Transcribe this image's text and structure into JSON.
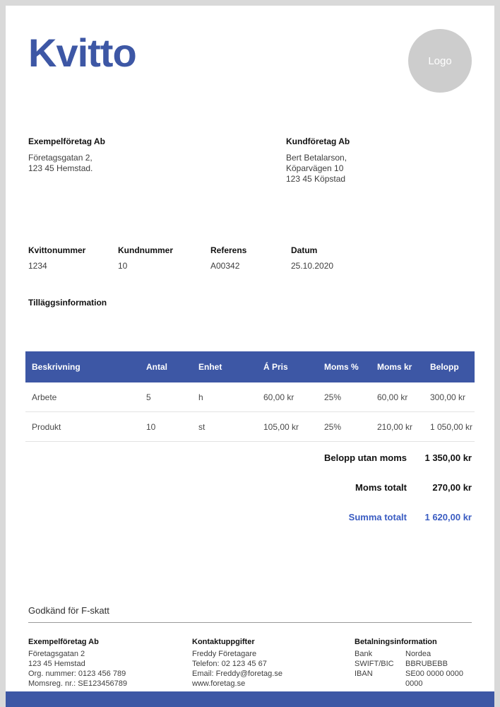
{
  "header": {
    "title": "Kvitto",
    "logo_text": "Logo"
  },
  "colors": {
    "accent": "#3D57A5",
    "summa": "#3A5CC2",
    "page_border": "#D9D9D9",
    "logo_bg": "#CDCDCD"
  },
  "seller": {
    "name": "Exempelföretag Ab",
    "lines": [
      "Företagsgatan 2,",
      "123 45 Hemstad."
    ]
  },
  "buyer": {
    "name": "Kundföretag Ab",
    "lines": [
      "Bert Betalarson,",
      "Köparvägen 10",
      "123 45 Köpstad"
    ]
  },
  "meta": {
    "fields": [
      {
        "label": "Kvittonummer",
        "value": "1234"
      },
      {
        "label": "Kundnummer",
        "value": "10"
      },
      {
        "label": "Referens",
        "value": "A00342"
      },
      {
        "label": "Datum",
        "value": "25.10.2020"
      }
    ]
  },
  "additional_info": {
    "label": "Tilläggsinformation"
  },
  "items_table": {
    "headers": [
      "Beskrivning",
      "Antal",
      "Enhet",
      "Á Pris",
      "Moms %",
      "Moms kr",
      "Belopp"
    ],
    "rows": [
      [
        "Arbete",
        "5",
        "h",
        "60,00 kr",
        "25%",
        "60,00 kr",
        "300,00 kr"
      ],
      [
        "Produkt",
        "10",
        "st",
        "105,00 kr",
        "25%",
        "210,00 kr",
        "1 050,00 kr"
      ]
    ]
  },
  "totals": {
    "rows": [
      {
        "label": "Belopp utan moms",
        "value": "1 350,00 kr"
      },
      {
        "label": "Moms totalt",
        "value": "270,00 kr"
      },
      {
        "label": "Summa totalt",
        "value": "1 620,00 kr"
      }
    ]
  },
  "tax_note": "Godkänd för F-skatt",
  "footer": {
    "company": {
      "heading": "Exempelföretag Ab",
      "lines": [
        "Företagsgatan 2",
        "123 45 Hemstad",
        "Org. nummer: 0123 456 789",
        "Momsreg. nr.: SE123456789"
      ]
    },
    "contact": {
      "heading": "Kontaktuppgifter",
      "lines": [
        "Freddy Företagare",
        "Telefon: 02 123 45 67",
        "Email: Freddy@foretag.se",
        "www.foretag.se"
      ]
    },
    "payment": {
      "heading": "Betalningsinformation",
      "rows": [
        {
          "label": "Bank",
          "value": "Nordea"
        },
        {
          "label": "SWIFT/BIC",
          "value": "BBRUBEBB"
        },
        {
          "label": "IBAN",
          "value": "SE00 0000 0000 0000"
        }
      ]
    }
  }
}
